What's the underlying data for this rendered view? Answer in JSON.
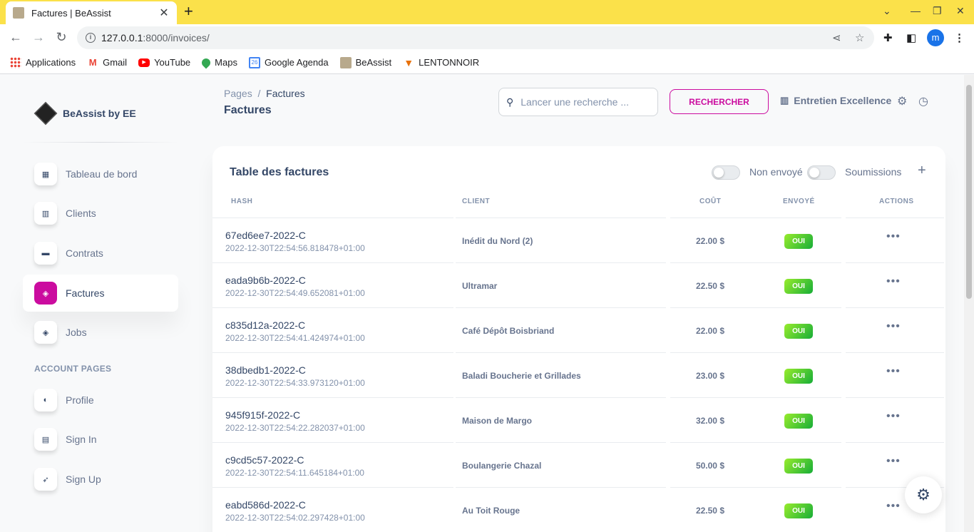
{
  "browser": {
    "tab_title": "Factures | BeAssist",
    "url_host": "127.0.0.1",
    "url_rest": ":8000/invoices/",
    "profile_initial": "m",
    "bookmarks": [
      {
        "label": "Applications",
        "icon": "apps-grid-icon",
        "color": "#4285f4"
      },
      {
        "label": "Gmail",
        "icon": "gmail-icon",
        "color": "#ea4335"
      },
      {
        "label": "YouTube",
        "icon": "youtube-icon",
        "color": "#ff0000"
      },
      {
        "label": "Maps",
        "icon": "maps-pin-icon",
        "color": "#34a853"
      },
      {
        "label": "Google Agenda",
        "icon": "calendar-icon",
        "color": "#4285f4"
      },
      {
        "label": "BeAssist",
        "icon": "beassist-favicon",
        "color": "#b8a98c"
      },
      {
        "label": "LENTONNOIR",
        "icon": "funnel-icon",
        "color": "#e8710a"
      }
    ]
  },
  "sidebar": {
    "brand": "BeAssist by EE",
    "items": [
      {
        "label": "Tableau de bord",
        "icon": "shop-icon"
      },
      {
        "label": "Clients",
        "icon": "office-icon"
      },
      {
        "label": "Contrats",
        "icon": "credit-card-icon"
      },
      {
        "label": "Factures",
        "icon": "box-3d-icon"
      },
      {
        "label": "Jobs",
        "icon": "box-3d-icon"
      }
    ],
    "account_title": "ACCOUNT PAGES",
    "account_items": [
      {
        "label": "Profile",
        "icon": "customer-support-icon"
      },
      {
        "label": "Sign In",
        "icon": "document-icon"
      },
      {
        "label": "Sign Up",
        "icon": "spaceship-icon"
      }
    ]
  },
  "header": {
    "breadcrumb_root": "Pages",
    "breadcrumb_sep": "/",
    "breadcrumb_current": "Factures",
    "title": "Factures",
    "search_placeholder": "Lancer une recherche ...",
    "search_button": "RECHERCHER",
    "organization": "Entretien Excellence"
  },
  "card": {
    "title": "Table des factures",
    "toggle_unsent": "Non envoyé",
    "toggle_submissions": "Soumissions",
    "columns": [
      "HASH",
      "CLIENT",
      "COÛT",
      "ENVOYÉ",
      "ACTIONS"
    ],
    "rows": [
      {
        "hash": "67ed6ee7-2022-C",
        "date": "2022-12-30T22:54:56.818478+01:00",
        "client": "Inédit du Nord (2)",
        "cout": "22.00 $",
        "envoye": "OUI"
      },
      {
        "hash": "eada9b6b-2022-C",
        "date": "2022-12-30T22:54:49.652081+01:00",
        "client": "Ultramar",
        "cout": "22.50 $",
        "envoye": "OUI"
      },
      {
        "hash": "c835d12a-2022-C",
        "date": "2022-12-30T22:54:41.424974+01:00",
        "client": "Café Dépôt Boisbriand",
        "cout": "22.00 $",
        "envoye": "OUI"
      },
      {
        "hash": "38dbedb1-2022-C",
        "date": "2022-12-30T22:54:33.973120+01:00",
        "client": "Baladi Boucherie et Grillades",
        "cout": "23.00 $",
        "envoye": "OUI"
      },
      {
        "hash": "945f915f-2022-C",
        "date": "2022-12-30T22:54:22.282037+01:00",
        "client": "Maison de Margo",
        "cout": "32.00 $",
        "envoye": "OUI"
      },
      {
        "hash": "c9cd5c57-2022-C",
        "date": "2022-12-30T22:54:11.645184+01:00",
        "client": "Boulangerie Chazal",
        "cout": "50.00 $",
        "envoye": "OUI"
      },
      {
        "hash": "eabd586d-2022-C",
        "date": "2022-12-30T22:54:02.297428+01:00",
        "client": "Au Toit Rouge",
        "cout": "22.50 $",
        "envoye": "OUI"
      }
    ]
  },
  "colors": {
    "accent": "#cb0c9f",
    "success": "#17ad37",
    "text": "#344767",
    "muted": "#8392ab",
    "tabstrip": "#fbe14a"
  }
}
